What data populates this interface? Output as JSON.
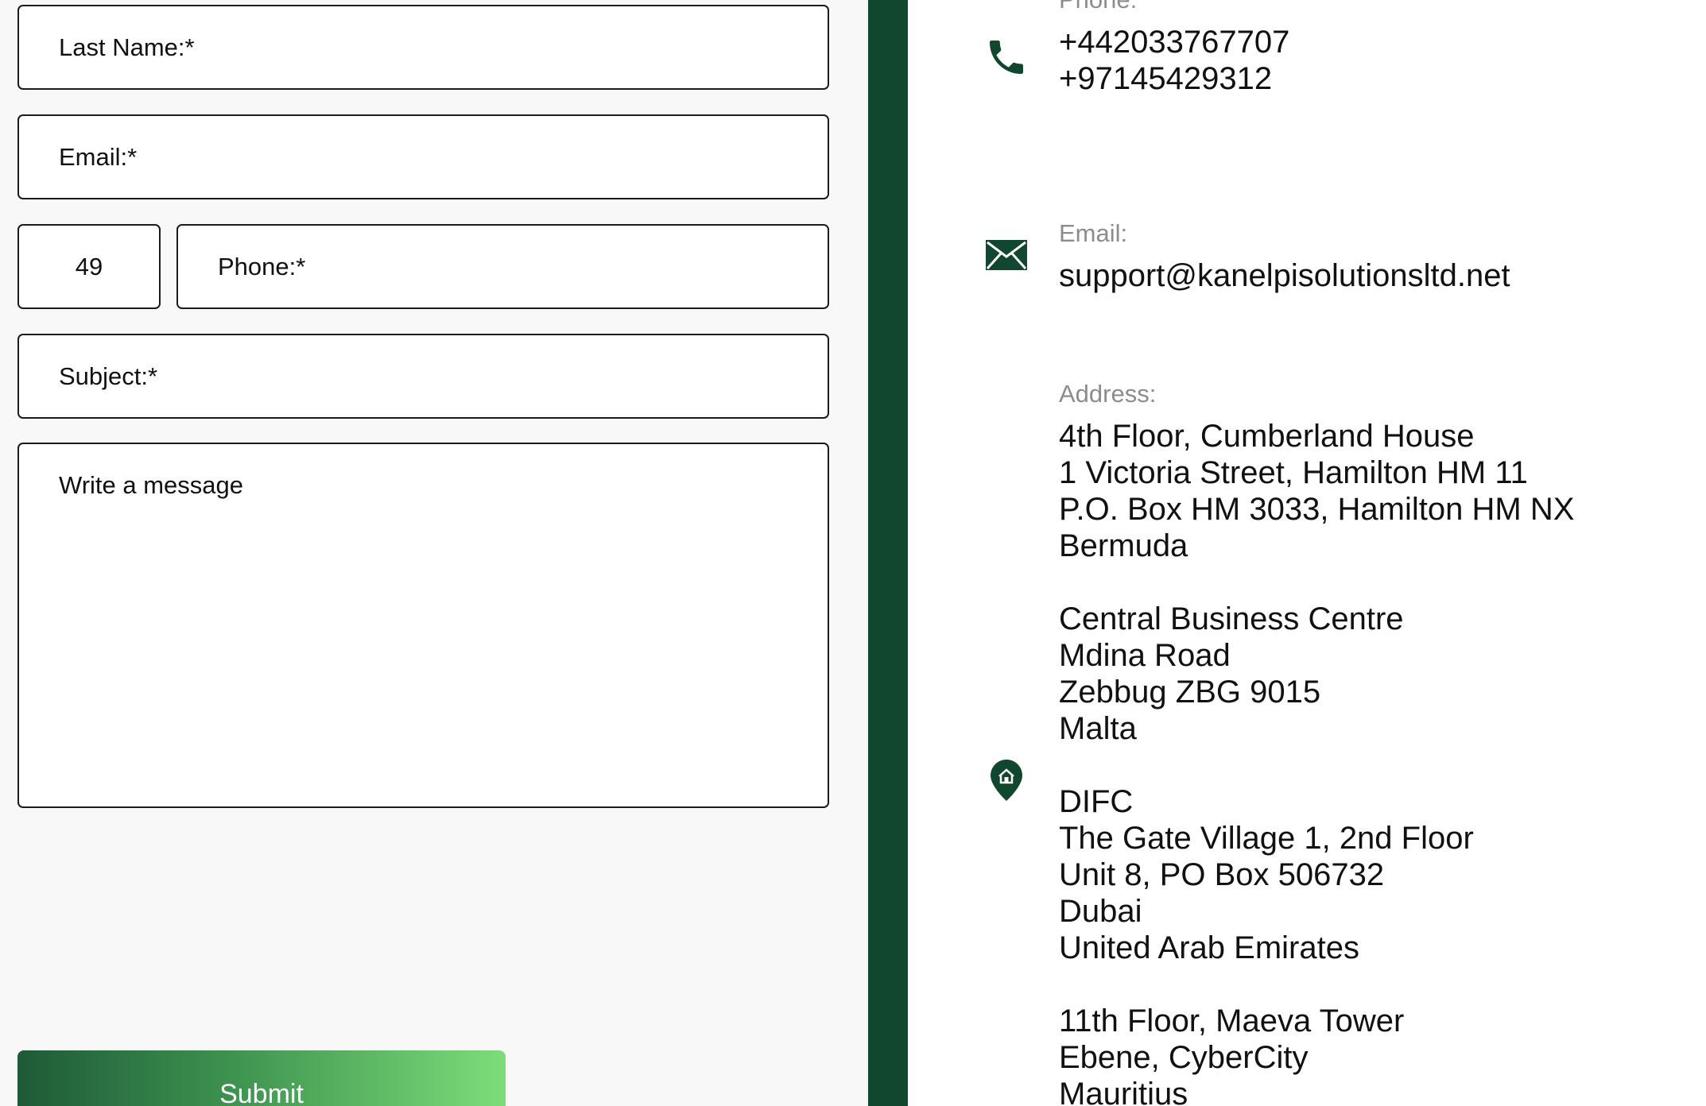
{
  "form": {
    "last_name_placeholder": "Last Name:*",
    "email_placeholder": "Email:*",
    "phone_code_value": "49",
    "phone_placeholder": "Phone:*",
    "subject_placeholder": "Subject:*",
    "message_placeholder": "Write a message",
    "submit_label": "Submit"
  },
  "contact": {
    "phone": {
      "label": "Phone:",
      "icon": "phone-icon",
      "numbers": [
        "+442033767707",
        "+97145429312"
      ]
    },
    "email": {
      "label": "Email:",
      "icon": "envelope-icon",
      "value": "support@kanelpisolutionsltd.net"
    },
    "address": {
      "label": "Address:",
      "icon": "location-pin-icon",
      "lines": [
        "4th Floor, Cumberland House",
        "1 Victoria Street, Hamilton HM 11",
        "P.O. Box HM 3033, Hamilton HM NX",
        "Bermuda",
        "",
        "Central Business Centre",
        "Mdina Road",
        "Zebbug ZBG 9015",
        "Malta",
        "",
        "DIFC",
        "The Gate Village 1, 2nd Floor",
        "Unit 8, PO Box 506732",
        "Dubai",
        "United Arab Emirates",
        "",
        "11th Floor, Maeva Tower",
        "Ebene, CyberCity",
        "Mauritius"
      ]
    }
  },
  "colors": {
    "brand_green": "#12472f",
    "form_background": "#f8f8f8",
    "label_gray": "#8c8c8c",
    "submit_gradient_start": "#1d5a37",
    "submit_gradient_end": "#7ddd79"
  }
}
